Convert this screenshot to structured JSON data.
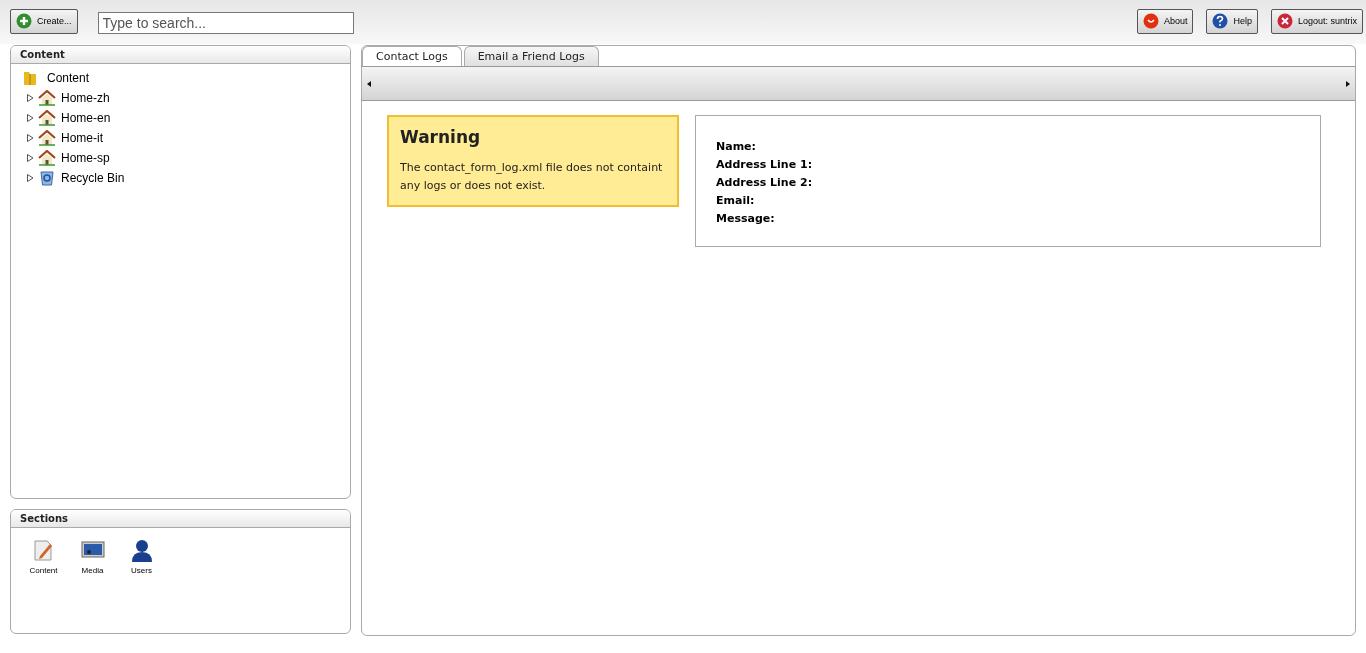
{
  "toolbar": {
    "create_button": "Create...",
    "search": {
      "placeholder": "Type to search..."
    },
    "buttons": [
      {
        "kind": "about",
        "label": "About"
      },
      {
        "kind": "help",
        "label": "Help"
      },
      {
        "kind": "logout",
        "label": "Logout: suntrix"
      }
    ]
  },
  "content_panel": {
    "title": "Content",
    "tree": [
      {
        "label": "Content",
        "kind": "folder",
        "children": [
          {
            "label": "Home-zh",
            "kind": "home",
            "expanded": false
          },
          {
            "label": "Home-en",
            "kind": "home",
            "expanded": false
          },
          {
            "label": "Home-it",
            "kind": "home",
            "expanded": false
          },
          {
            "label": "Home-sp",
            "kind": "home",
            "expanded": false
          },
          {
            "label": "Recycle Bin",
            "kind": "recycle_bin",
            "expanded": false
          }
        ]
      }
    ]
  },
  "sections_panel": {
    "title": "Sections",
    "items": [
      {
        "kind": "content",
        "label": "Content"
      },
      {
        "kind": "media",
        "label": "Media"
      },
      {
        "kind": "users",
        "label": "Users"
      }
    ]
  },
  "tabs": [
    {
      "label": "Contact Logs",
      "selected": true
    },
    {
      "label": "Email a Friend Logs",
      "selected": false
    }
  ],
  "warning": {
    "title": "Warning",
    "message": "The contact_form_log.xml file does not containt any logs or does not exist."
  },
  "details": {
    "fields": [
      "Name:",
      "Address Line 1:",
      "Address Line 2:",
      "Email:",
      "Message:"
    ]
  }
}
